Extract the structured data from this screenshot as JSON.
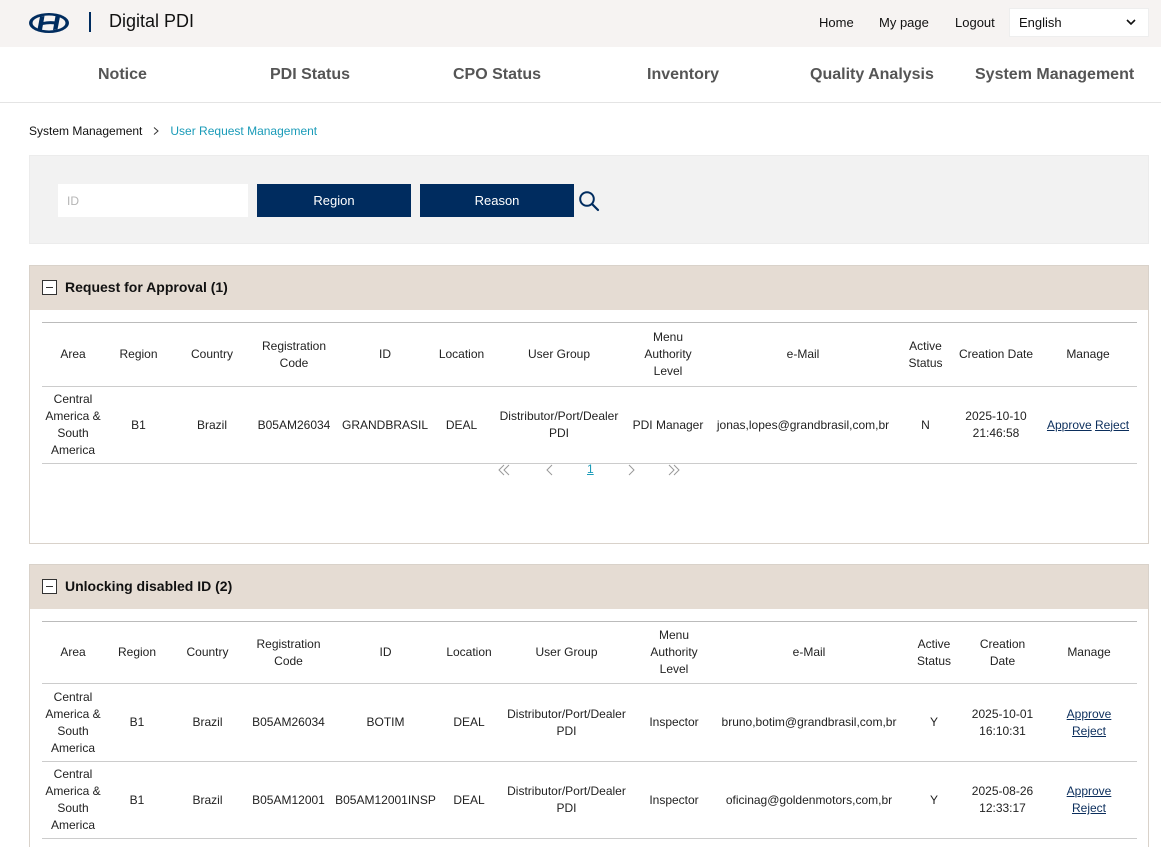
{
  "header": {
    "app_title": "Digital PDI",
    "links": {
      "home": "Home",
      "mypage": "My page",
      "logout": "Logout"
    },
    "language": "English",
    "brand_color": "#002c5f"
  },
  "nav": [
    "Notice",
    "PDI Status",
    "CPO Status",
    "Inventory",
    "Quality Analysis",
    "System Management"
  ],
  "breadcrumb": {
    "parent": "System Management",
    "current": "User Request Management"
  },
  "search": {
    "id_placeholder": "ID",
    "region_label": "Region",
    "reason_label": "Reason"
  },
  "sections": [
    {
      "title": "Request for Approval (1)",
      "headers": [
        "Area",
        "Region",
        "Country",
        "Registration Code",
        "ID",
        "Location",
        "User Group",
        "Menu Authority Level",
        "e-Mail",
        "Active Status",
        "Creation Date",
        "Manage"
      ],
      "rows": [
        {
          "area": "Central America & South America",
          "region": "B1",
          "country": "Brazil",
          "reg_code": "B05AM26034",
          "id": "GRANDBRASIL",
          "location": "DEAL",
          "user_group": "Distributor/Port/Dealer PDI",
          "authority": "PDI Manager",
          "email": "jonas,lopes@grandbrasil,com,br",
          "active": "N",
          "created": "2025-10-10 21:46:58",
          "approve": "Approve",
          "reject": "Reject"
        }
      ],
      "pager": {
        "current_page": "1"
      }
    },
    {
      "title": "Unlocking disabled ID (2)",
      "headers": [
        "Area",
        "Region",
        "Country",
        "Registration Code",
        "ID",
        "Location",
        "User Group",
        "Menu Authority Level",
        "e-Mail",
        "Active Status",
        "Creation Date",
        "Manage"
      ],
      "rows": [
        {
          "area": "Central America & South America",
          "region": "B1",
          "country": "Brazil",
          "reg_code": "B05AM26034",
          "id": "BOTIM",
          "location": "DEAL",
          "user_group": "Distributor/Port/Dealer PDI",
          "authority": "Inspector",
          "email": "bruno,botim@grandbrasil,com,br",
          "active": "Y",
          "created": "2025-10-01 16:10:31",
          "approve": "Approve",
          "reject": "Reject"
        },
        {
          "area": "Central America & South America",
          "region": "B1",
          "country": "Brazil",
          "reg_code": "B05AM12001",
          "id": "B05AM12001INSP",
          "location": "DEAL",
          "user_group": "Distributor/Port/Dealer PDI",
          "authority": "Inspector",
          "email": "oficinag@goldenmotors,com,br",
          "active": "Y",
          "created": "2025-08-26 12:33:17",
          "approve": "Approve",
          "reject": "Reject"
        }
      ]
    }
  ]
}
